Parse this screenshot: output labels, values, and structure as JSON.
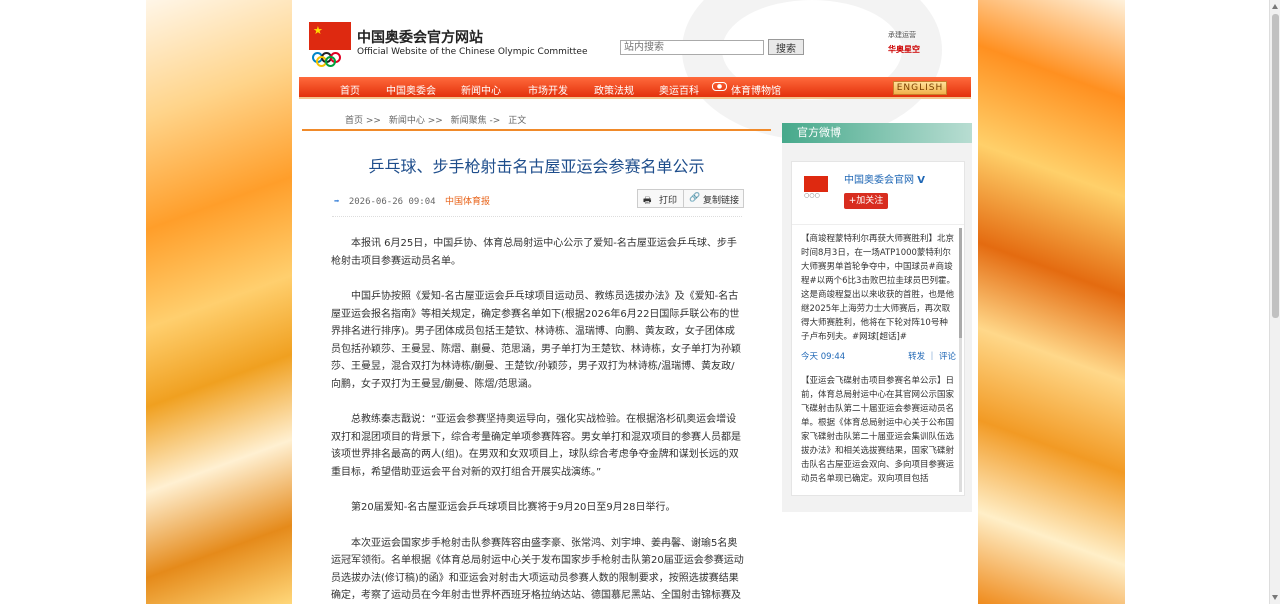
{
  "site": {
    "name_cn": "中国奥委会官方网站",
    "name_en": "Official Website of the Chinese Olympic Committee",
    "sponsor_line1": "承建运营",
    "sponsor_line2": "华奥星空"
  },
  "search": {
    "placeholder": "站内搜索",
    "button": "搜索"
  },
  "nav": {
    "items": [
      "首页",
      "中国奥委会",
      "新闻中心",
      "市场开发",
      "政策法规",
      "奥运百科",
      "体育博物馆"
    ],
    "english": "ENGLISH"
  },
  "breadcrumb": [
    "首页 >>",
    "新闻中心 >>",
    "新闻聚焦 ->",
    "正文"
  ],
  "article": {
    "title": "乒乓球、步手枪射击名古屋亚运会参赛名单公示",
    "datetime": "2026-06-26 09:04",
    "source": "中国体育报",
    "print": "打印",
    "copy_link": "复制链接",
    "paragraphs": [
      "本报讯 6月25日，中国乒协、体育总局射运中心公示了爱知-名古屋亚运会乒乓球、步手枪射击项目参赛运动员名单。",
      "中国乒协按照《爱知-名古屋亚运会乒乓球项目运动员、教练员选拔办法》及《爱知-名古屋亚运会报名指南》等相关规定，确定参赛名单如下(根据2026年6月22日国际乒联公布的世界排名进行排序)。男子团体成员包括王楚钦、林诗栋、温瑞博、向鹏、黄友政，女子团体成员包括孙颖莎、王曼昱、陈熠、蒯曼、范思涵，男子单打为王楚钦、林诗栋，女子单打为孙颖莎、王曼昱，混合双打为林诗栋/蒯曼、王楚钦/孙颖莎，男子双打为林诗栋/温瑞博、黄友政/向鹏，女子双打为王曼昱/蒯曼、陈熠/范思涵。",
      "总教练秦志戬说：“亚运会参赛坚持奥运导向，强化实战检验。在根据洛杉矶奥运会增设双打和混团项目的背景下，综合考量确定单项参赛阵容。男女单打和混双项目的参赛人员都是该项世界排名最高的两人(组)。在男双和女双项目上，球队综合考虑争夺金牌和谋划长远的双重目标，希望借助亚运会平台对新的双打组合开展实战演练。”",
      "第20届爱知-名古屋亚运会乒乓球项目比赛将于9月20日至9月28日举行。",
      "本次亚运会国家步手枪射击队参赛阵容由盛李豪、张常鸿、刘宇坤、姜冉馨、谢瑜5名奥运冠军领衔。名单根据《体育总局射运中心关于发布国家步手枪射击队第20届亚运会参赛运动员选拔办法(修订稿)的函》和亚运会对射击大项运动员参赛人数的限制要求，按照选拔赛结果确定，考察了运动员在今年射击世界杯西班牙格拉纳达站、德国慕尼黑站、全国射击锦标赛及"
    ]
  },
  "sidebar": {
    "title": "官方微博",
    "weibo_name": "中国奥委会官网",
    "weibo_v": "V",
    "follow": "+加关注",
    "posts": [
      {
        "text": "【商竣程蒙特利尔再获大师赛胜利】北京时间8月3日，在一场ATP1000蒙特利尔大师赛男单首轮争夺中，中国球员#商竣程#以两个6比3击败巴拉圭球员巴列霍。这是商竣程复出以来收获的首胜，也是他继2025年上海劳力士大师赛后，再次取得大师赛胜利，他将在下轮对阵10号种子卢布列夫。#网球[超话]#",
        "time": "今天 09:44",
        "actions": "转发 ｜ 评论"
      },
      {
        "text": "【亚运会飞碟射击项目参赛名单公示】日前，体育总局射运中心在其官网公示国家飞碟射击队第二十届亚运会参赛运动员名单。根据《体育总局射运中心关于公布国家飞碟射击队第二十届亚运会集训队伍选拔办法》和相关选拔赛结果，国家飞碟射击队名古屋亚运会双向、多向项目参赛运动员名单现已确定。双向项目包括",
        "time": "",
        "actions": ""
      }
    ]
  },
  "colors": {
    "nav_red": "#e3310b",
    "title_blue": "#1f4e8c",
    "accent_orange": "#f08a2a",
    "sidebar_green": "#46a98b"
  }
}
